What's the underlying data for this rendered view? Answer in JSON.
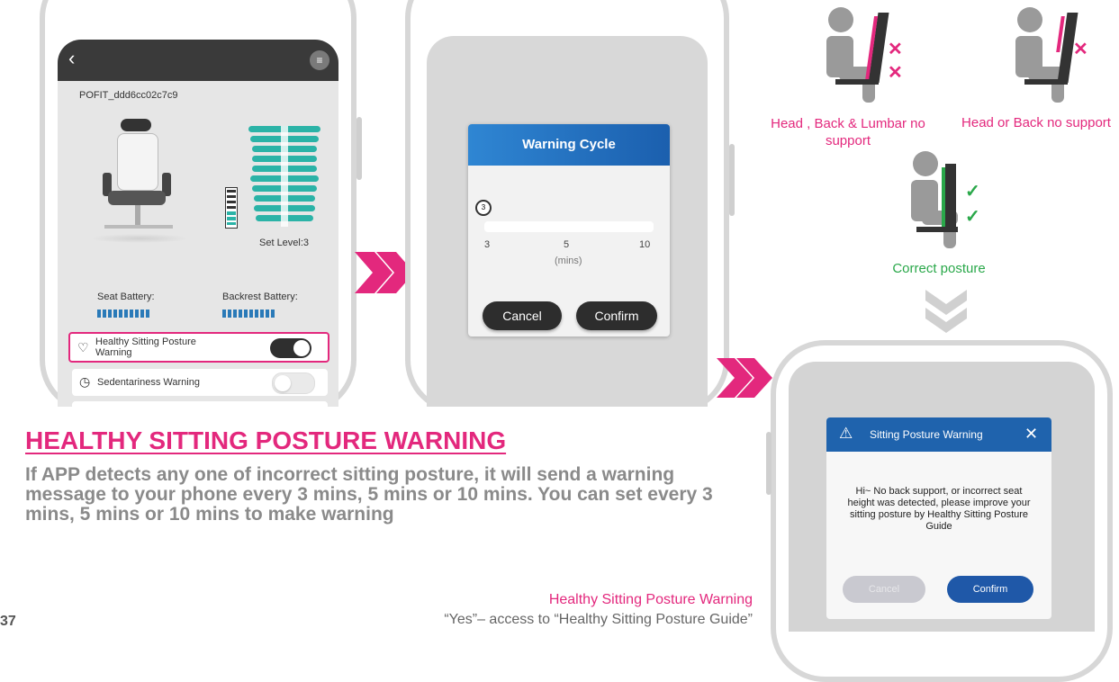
{
  "phone1": {
    "device_name": "POFIT_ddd6cc02c7c9",
    "set_level": "Set Level:3",
    "seat_battery_label": "Seat Battery:",
    "backrest_battery_label": "Backrest Battery:",
    "healthy_warning_label": "Healthy Sitting Posture Warning",
    "healthy_warning_on": true,
    "sedentary_label": "Sedentariness Warning",
    "sedentary_on": false
  },
  "phone2": {
    "dialog_title": "Warning Cycle",
    "slider_value": "3",
    "tick_labels": [
      "3",
      "5",
      "10"
    ],
    "unit": "(mins)",
    "cancel": "Cancel",
    "confirm": "Confirm"
  },
  "postures": {
    "bad1": "Head , Back & Lumbar no support",
    "bad2": "Head or Back no support",
    "good": "Correct posture"
  },
  "phone3": {
    "dialog_title": "Sitting Posture Warning",
    "message": "Hi~ No back support, or incorrect seat height was detected, please improve your sitting posture by Healthy Sitting Posture Guide",
    "cancel": "Cancel",
    "confirm": "Confirm"
  },
  "text": {
    "heading": "HEALTHY SITTING POSTURE WARNING",
    "body": "If APP detects any one of incorrect sitting posture, it will send a warning message to your phone every 3 mins, 5 mins or 10 mins. You can set every 3 mins, 5 mins or 10 mins to make warning",
    "caption_title": "Healthy Sitting Posture Warning",
    "caption_line": "“Yes”– access to “Healthy Sitting Posture Guide”",
    "page_number": "37"
  },
  "colors": {
    "accent_pink": "#e3287d",
    "dialog_blue": "#1f63ad",
    "teal": "#2bb3a7",
    "green": "#2aa84a"
  }
}
